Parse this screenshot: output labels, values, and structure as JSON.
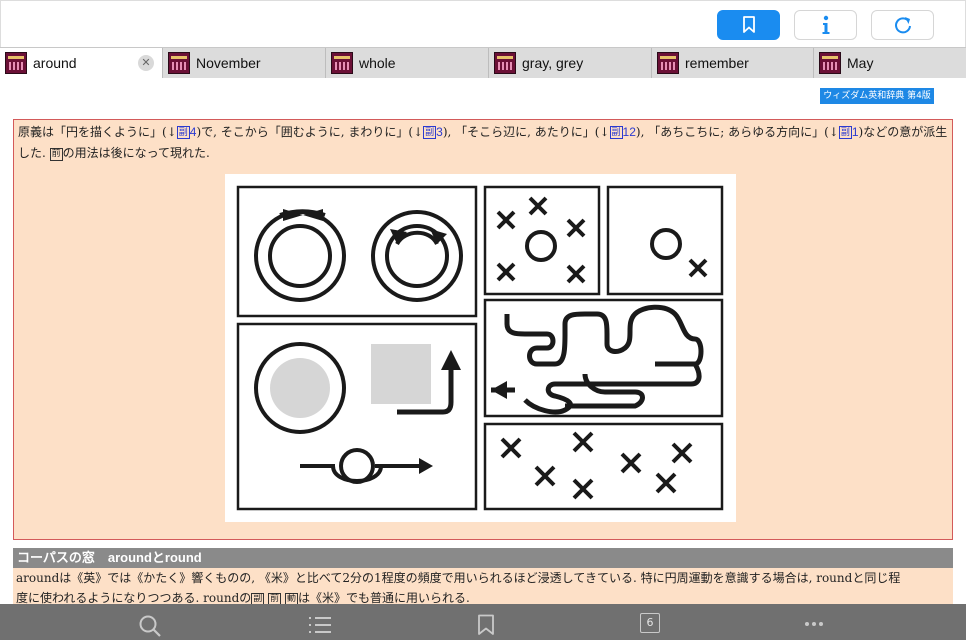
{
  "toolbar": {
    "buttons": [
      {
        "name": "bookmark-button",
        "icon": "bookmark-icon"
      },
      {
        "name": "info-button",
        "icon": "info-icon"
      },
      {
        "name": "refresh-button",
        "icon": "refresh-icon"
      }
    ],
    "accent_color": "#1a8cf0"
  },
  "tabs": [
    {
      "label": "around",
      "active": true,
      "closable": true
    },
    {
      "label": "November"
    },
    {
      "label": "whole"
    },
    {
      "label": "gray, grey"
    },
    {
      "label": "remember"
    },
    {
      "label": "May"
    }
  ],
  "source_badge": "ウィズダム英和辞典 第4版",
  "origin": {
    "part1": "原義は「円を描くように」(",
    "arrow": "↓",
    "ref1_box": "副",
    "ref1_num": "4",
    "part2": ")で, そこから「囲むように, まわりに」(",
    "ref2_box": "副",
    "ref2_num": "3",
    "part3": "), 「そこら辺に, あたりに」(",
    "ref3_box": "副",
    "ref3_num": "12",
    "part4": "), 「あちこちに; あらゆる方向に」(",
    "ref4_box": "副",
    "ref4_num": "1",
    "part5": ")などの意が派生した. ",
    "box_prep": "前",
    "part6": "の用法は後になって現れた."
  },
  "corpus": {
    "title": "コーパスの窓　aroundとround",
    "line1a": "aroundは《英》では《かたく》響くものの, 《米》と比べて2分の1程度の頻度で用いられるほど浸透してきている. 特に円周運動を意識する場合は, roundと同じ程",
    "line2a": "度に使われるようになりつつある. roundの",
    "box_adv": "副",
    "box_prep": "前",
    "box_verb": "動",
    "line2b": "は《米》でも普通に用いられる."
  },
  "bottom_bar": {
    "icons": [
      "search-icon",
      "list-icon",
      "bookmark-icon",
      "tabs-count",
      "more-icon"
    ],
    "tab_count": "6"
  }
}
